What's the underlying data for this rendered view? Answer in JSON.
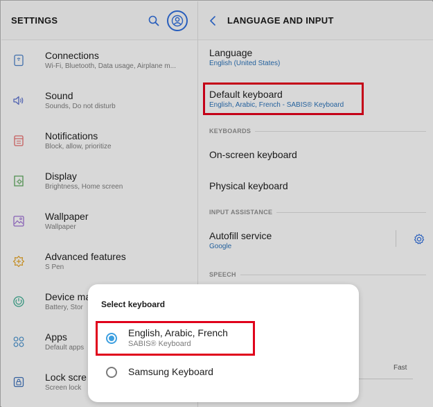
{
  "left": {
    "title": "SETTINGS",
    "search_icon": "search-icon",
    "account_icon": "account-icon",
    "items": [
      {
        "label": "Connections",
        "sub": "Wi-Fi, Bluetooth, Data usage, Airplane m...",
        "icon": "connections-icon"
      },
      {
        "label": "Sound",
        "sub": "Sounds, Do not disturb",
        "icon": "sound-icon"
      },
      {
        "label": "Notifications",
        "sub": "Block, allow, prioritize",
        "icon": "notifications-icon"
      },
      {
        "label": "Display",
        "sub": "Brightness, Home screen",
        "icon": "display-icon"
      },
      {
        "label": "Wallpaper",
        "sub": "Wallpaper",
        "icon": "wallpaper-icon"
      },
      {
        "label": "Advanced features",
        "sub": "S Pen",
        "icon": "advanced-features-icon"
      },
      {
        "label": "Device ma",
        "sub": "Battery, Stor",
        "icon": "device-maintenance-icon"
      },
      {
        "label": "Apps",
        "sub": "Default apps",
        "icon": "apps-icon"
      },
      {
        "label": "Lock scre",
        "sub": "Screen lock",
        "icon": "lock-screen-icon"
      }
    ]
  },
  "right": {
    "title": "LANGUAGE AND INPUT",
    "language": {
      "label": "Language",
      "sub": "English (United States)"
    },
    "default_keyboard": {
      "label": "Default keyboard",
      "sub": "English, Arabic, French - SABIS® Keyboard"
    },
    "section_keyboards": "KEYBOARDS",
    "onscreen_keyboard": "On-screen keyboard",
    "physical_keyboard": "Physical keyboard",
    "section_input_assistance": "INPUT ASSISTANCE",
    "autofill": {
      "label": "Autofill service",
      "sub": "Google"
    },
    "section_speech": "SPEECH",
    "speed_fast": "Fast"
  },
  "dialog": {
    "title": "Select keyboard",
    "options": [
      {
        "label": "English, Arabic, French",
        "sub": "SABIS® Keyboard",
        "selected": true
      },
      {
        "label": "Samsung Keyboard",
        "sub": "",
        "selected": false
      }
    ]
  },
  "colors": {
    "accent_blue": "#2e6bd6",
    "link_blue": "#2a6fb3",
    "radio_on": "#3d9fe0",
    "highlight_red": "#e0001b"
  }
}
